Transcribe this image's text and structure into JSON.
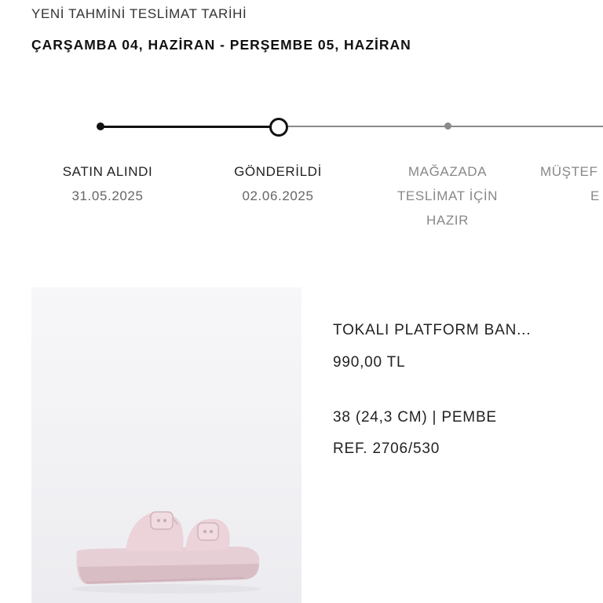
{
  "header": {
    "subtitle": "YENİ TAHMİNİ TESLİMAT TARİHİ",
    "delivery_range": "ÇARŞAMBA 04, HAZİRAN - PERŞEMBE 05, HAZİRAN"
  },
  "tracking": {
    "steps": [
      {
        "label": "SATIN ALINDI",
        "date": "31.05.2025",
        "status": "done"
      },
      {
        "label": "GÖNDERİLDİ",
        "date": "02.06.2025",
        "status": "current"
      },
      {
        "label": "MAĞAZADA TESLİMAT İÇİN HAZIR",
        "label_lines": [
          "MAĞAZADA",
          "TESLİMAT İÇİN",
          "HAZIR"
        ],
        "date": "",
        "status": "pending"
      },
      {
        "label_partial": "MÜŞTEF",
        "date_partial": "E",
        "status": "pending"
      }
    ]
  },
  "product": {
    "name": "TOKALI PLATFORM BAN...",
    "price": "990,00 TL",
    "variant": "38 (24,3 CM) | PEMBE",
    "ref": "REF. 2706/530",
    "image_icon": "pink-platform-sandal"
  },
  "colors": {
    "active": "#111111",
    "inactive": "#8a8a8a",
    "sandal": "#e8cfd5"
  }
}
